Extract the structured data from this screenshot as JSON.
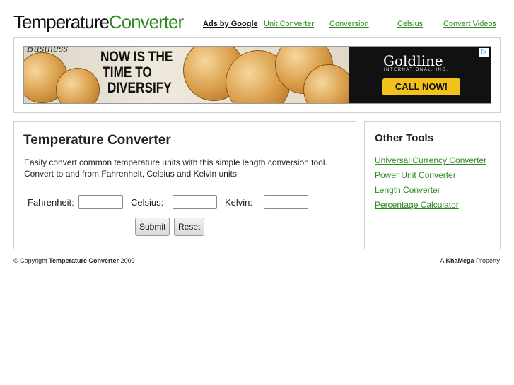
{
  "header": {
    "logo_word1": "Temperature",
    "logo_word2": "Converter",
    "ads_label": "Ads by Google",
    "links": [
      "Unit Converter",
      "Conversion",
      "Celsius",
      "Convert Videos"
    ]
  },
  "ad": {
    "masthead": "Business",
    "headline_lines": [
      "NOW IS THE",
      "TIME TO",
      "DIVERSIFY"
    ],
    "brand": "Goldline",
    "brand_sub": "INTERNATIONAL, INC.",
    "cta": "CALL NOW!",
    "adchoices": "▷"
  },
  "main": {
    "title": "Temperature Converter",
    "description": "Easily convert common temperature units with this simple length conversion tool. Convert to and from Fahrenheit, Celsius and Kelvin units.",
    "fields": [
      {
        "label": "Fahrenheit:",
        "value": ""
      },
      {
        "label": "Celsius:",
        "value": ""
      },
      {
        "label": "Kelvin:",
        "value": ""
      }
    ],
    "submit_label": "Submit",
    "reset_label": "Reset"
  },
  "sidebar": {
    "title": "Other Tools",
    "links": [
      "Universal Currency Converter",
      "Power Unit Converter",
      "Length Converter",
      "Percentage Calculator"
    ]
  },
  "footer": {
    "copyright_prefix": "© Copyright",
    "copyright_name": "Temperature Converter",
    "copyright_year": "2009",
    "property_prefix": "A",
    "property_name": "KhaMega",
    "property_suffix": "Property"
  },
  "colors": {
    "accent_green": "#2d8a1f",
    "ad_button_yellow": "#f3c21a"
  }
}
